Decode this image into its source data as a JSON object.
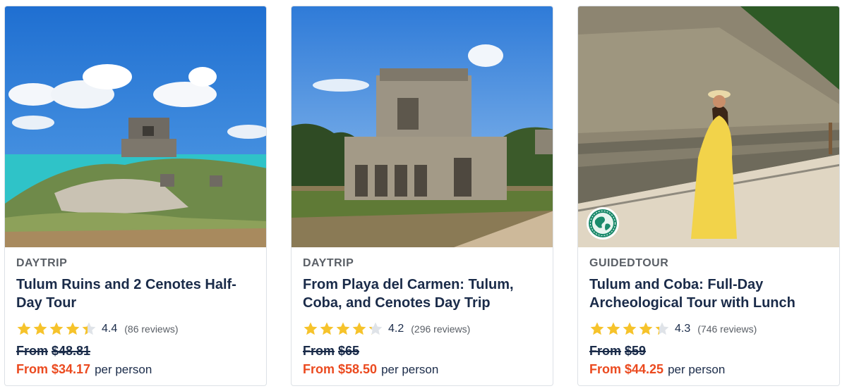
{
  "cards": [
    {
      "category": "DAYTRIP",
      "title": "Tulum Ruins and 2 Cenotes Half-Day Tour",
      "rating": "4.4",
      "rating_value": 4.4,
      "reviews": "(86 reviews)",
      "old_price_prefix": "From",
      "old_price": "$48.81",
      "new_price_prefix": "From",
      "new_price": "$34.17",
      "per": "per person",
      "image": "tulum-ruins-coastline-photo"
    },
    {
      "category": "DAYTRIP",
      "title": "From Playa del Carmen: Tulum, Coba, and Cenotes Day Trip",
      "rating": "4.2",
      "rating_value": 4.2,
      "reviews": "(296 reviews)",
      "old_price_prefix": "From",
      "old_price": "$65",
      "new_price_prefix": "From",
      "new_price": "$58.50",
      "per": "per person",
      "image": "mayan-temple-photo"
    },
    {
      "category": "GUIDEDTOUR",
      "title": "Tulum and Coba: Full-Day Archeological Tour with Lunch",
      "rating": "4.3",
      "rating_value": 4.3,
      "reviews": "(746 reviews)",
      "old_price_prefix": "From",
      "old_price": "$59",
      "new_price_prefix": "From",
      "new_price": "$44.25",
      "per": "per person",
      "image": "coba-ballcourt-woman-photo",
      "badge": "eco-globe-icon"
    }
  ],
  "colors": {
    "title": "#1a2b49",
    "category": "#5a5f66",
    "star": "#f6c32b",
    "sale_price": "#eb4a1f",
    "badge_green": "#1b8a6b"
  }
}
